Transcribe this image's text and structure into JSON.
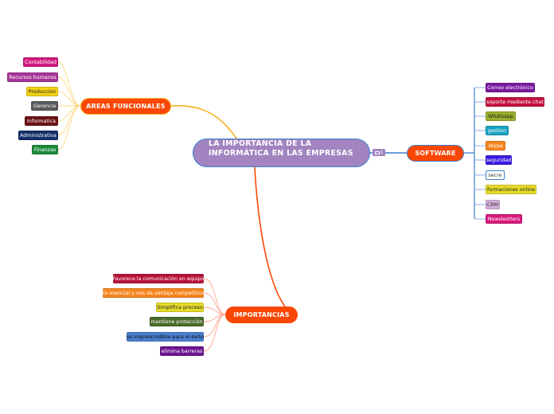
{
  "root": {
    "title_line1": "LA IMPORTANCIA DE LA",
    "title_line2": "INFORMÁTICA EN LAS EMPRESAS",
    "comment_count": "1",
    "color": "#a284c1"
  },
  "branches": {
    "areas": {
      "label": "AREAS FUNCIONALES",
      "line_color": "#f5b21d",
      "items": [
        {
          "label": "Contabilidad",
          "bg": "#d0197e",
          "fg": "#ffffff"
        },
        {
          "label": "Recursos humanos",
          "bg": "#a8359a",
          "fg": "#ffffff"
        },
        {
          "label": "Produccion",
          "bg": "#f3d216",
          "fg": "#222222"
        },
        {
          "label": "Gerencia",
          "bg": "#5a5a5a",
          "fg": "#ffffff"
        },
        {
          "label": "Informatica",
          "bg": "#6b1212",
          "fg": "#ffffff"
        },
        {
          "label": "Administrativa",
          "bg": "#13306b",
          "fg": "#ffffff"
        },
        {
          "label": "Finanzas",
          "bg": "#1c8a3c",
          "fg": "#ffffff"
        }
      ]
    },
    "software": {
      "label": "SOFTWARE",
      "line_color": "#3d7fce",
      "items": [
        {
          "label": "Correo electrónico",
          "bg": "#7a1aa0",
          "fg": "#ffffff"
        },
        {
          "label": "soporte mediante chat",
          "bg": "#c3123e",
          "fg": "#ffffff"
        },
        {
          "label": "Whatsapp",
          "bg": "#9bad2e",
          "fg": "#222222"
        },
        {
          "label": "gestion",
          "bg": "#1aa3c0",
          "fg": "#ffffff"
        },
        {
          "label": "skype",
          "bg": "#f5851e",
          "fg": "#ffffff"
        },
        {
          "label": "seguridad",
          "bg": "#3a1ae0",
          "fg": "#ffffff"
        },
        {
          "label": "secre",
          "bg": "#ffffff",
          "fg": "#333333"
        },
        {
          "label": "formaciones online",
          "bg": "#e6dc2a",
          "fg": "#222222"
        },
        {
          "label": "CRM",
          "bg": "#d4b1dc",
          "fg": "#333333"
        },
        {
          "label": "Newslestters",
          "bg": "#d81a7e",
          "fg": "#ffffff"
        }
      ]
    },
    "importancias": {
      "label": "IMPORTANCIAS",
      "line_color": "#fa4705",
      "items": [
        {
          "label": "Favorece la comunicación en equipo",
          "bg": "#b8123a",
          "fg": "#ffffff"
        },
        {
          "label": "Es esencial y nos da ventaja competitiva",
          "bg": "#f5851e",
          "fg": "#ffffff"
        },
        {
          "label": "Simplifica proceso",
          "bg": "#e6dc2a",
          "fg": "#222222"
        },
        {
          "label": "mantiene protección",
          "bg": "#4a6a2a",
          "fg": "#ffffff"
        },
        {
          "label": "es imprescindible para el éxito",
          "bg": "#4a7fcf",
          "fg": "#111111"
        },
        {
          "label": "elimina barreras",
          "bg": "#6d1490",
          "fg": "#ffffff"
        }
      ]
    }
  }
}
